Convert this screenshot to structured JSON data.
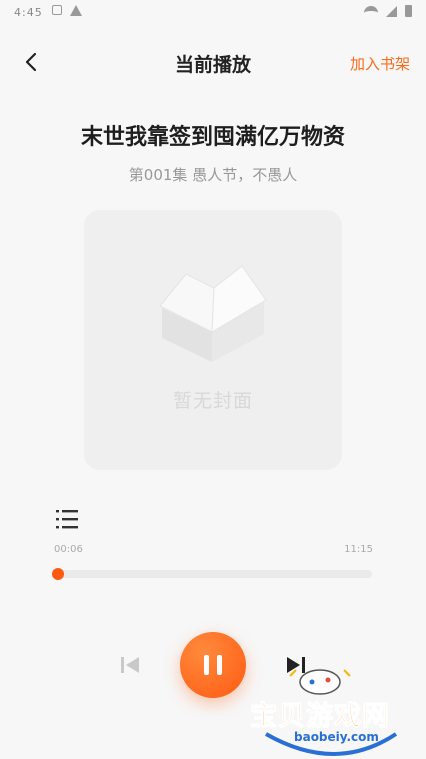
{
  "status_bar": {
    "time": "4:45"
  },
  "header": {
    "title": "当前播放",
    "add_to_shelf_label": "加入书架"
  },
  "book": {
    "title": "末世我靠签到囤满亿万物资",
    "chapter": "第001集 愚人节，不愚人"
  },
  "cover": {
    "placeholder_text": "暂无封面"
  },
  "player": {
    "current_time": "00:06",
    "total_time": "11:15",
    "progress_fraction": 0.009,
    "state": "playing",
    "accent_color": "#ff6a1a"
  },
  "watermark": {
    "text": "宝贝游戏网",
    "url": "baobeiy.com"
  }
}
